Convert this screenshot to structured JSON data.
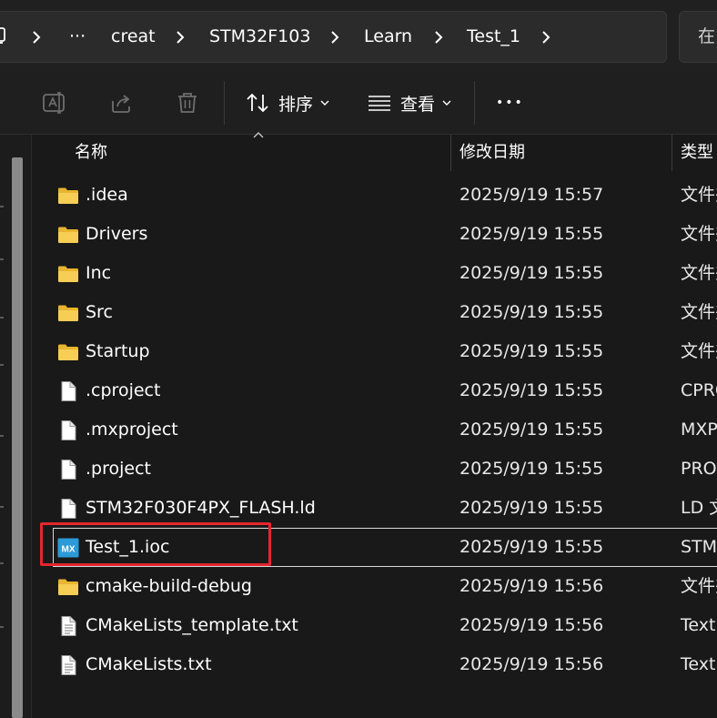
{
  "address_bar": {
    "crumbs": [
      "creat",
      "STM32F103",
      "Learn",
      "Test_1"
    ],
    "overflow": "···",
    "search_text": "在"
  },
  "toolbar": {
    "sort_label": "排序",
    "view_label": "查看",
    "more_label": "•••"
  },
  "columns": {
    "name": "名称",
    "modified": "修改日期",
    "type": "类型"
  },
  "files": [
    {
      "name": ".idea",
      "modified": "2025/9/19 15:57",
      "type": "文件夹",
      "icon": "folder-icon"
    },
    {
      "name": "Drivers",
      "modified": "2025/9/19 15:55",
      "type": "文件夹",
      "icon": "folder-icon"
    },
    {
      "name": "Inc",
      "modified": "2025/9/19 15:55",
      "type": "文件夹",
      "icon": "folder-icon"
    },
    {
      "name": "Src",
      "modified": "2025/9/19 15:55",
      "type": "文件夹",
      "icon": "folder-icon"
    },
    {
      "name": "Startup",
      "modified": "2025/9/19 15:55",
      "type": "文件夹",
      "icon": "folder-icon"
    },
    {
      "name": ".cproject",
      "modified": "2025/9/19 15:55",
      "type": "CPRO",
      "icon": "file-icon"
    },
    {
      "name": ".mxproject",
      "modified": "2025/9/19 15:55",
      "type": "MXP",
      "icon": "file-icon"
    },
    {
      "name": ".project",
      "modified": "2025/9/19 15:55",
      "type": "PRO",
      "icon": "file-icon"
    },
    {
      "name": "STM32F030F4PX_FLASH.ld",
      "modified": "2025/9/19 15:55",
      "type": "LD 文",
      "icon": "file-icon"
    },
    {
      "name": "Test_1.ioc",
      "modified": "2025/9/19 15:55",
      "type": "STM",
      "icon": "mx-icon"
    },
    {
      "name": "cmake-build-debug",
      "modified": "2025/9/19 15:56",
      "type": "文件夹",
      "icon": "folder-icon"
    },
    {
      "name": "CMakeLists_template.txt",
      "modified": "2025/9/19 15:56",
      "type": "Text",
      "icon": "text-file-icon"
    },
    {
      "name": "CMakeLists.txt",
      "modified": "2025/9/19 15:56",
      "type": "Text",
      "icon": "text-file-icon"
    }
  ],
  "selected_index": 9,
  "colors": {
    "background": "#191919",
    "highlight": "#e5262c",
    "folder": "#f0c040",
    "mx_icon": "#2a9ad8"
  }
}
